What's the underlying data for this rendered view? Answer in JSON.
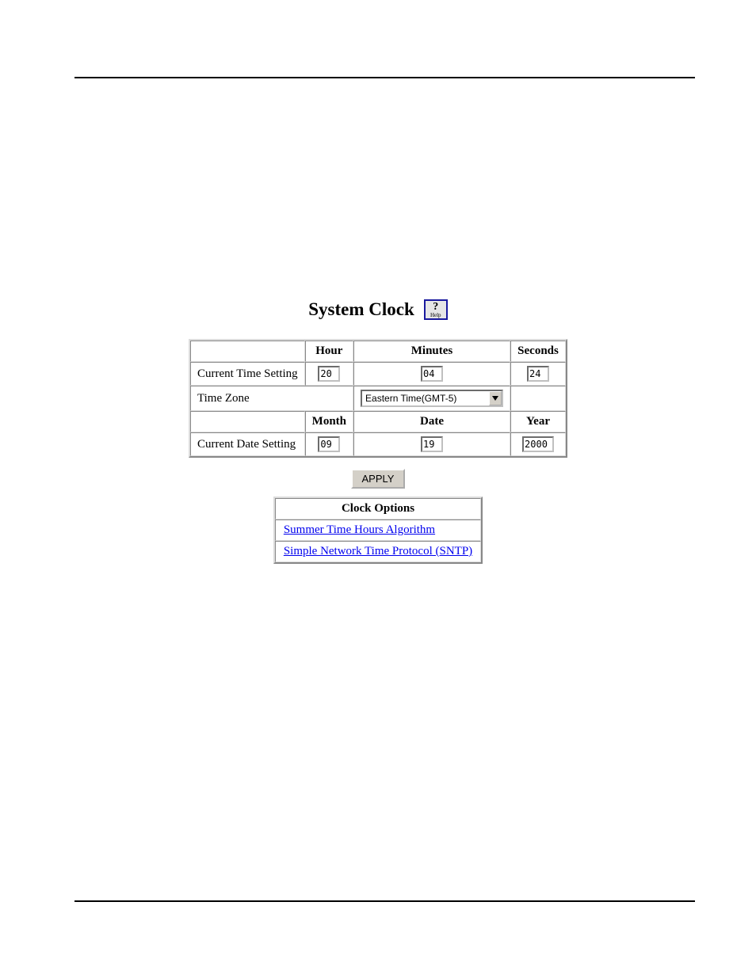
{
  "title": "System Clock",
  "help_label": "Help",
  "headers": {
    "hour": "Hour",
    "minutes": "Minutes",
    "seconds": "Seconds",
    "month": "Month",
    "date": "Date",
    "year": "Year"
  },
  "rows": {
    "current_time": "Current Time Setting",
    "time_zone": "Time Zone",
    "current_date": "Current Date Setting"
  },
  "time": {
    "hour": "20",
    "minutes": "04",
    "seconds": "24"
  },
  "timezone": "Eastern Time(GMT-5)",
  "date": {
    "month": "09",
    "day": "19",
    "year": "2000"
  },
  "apply_label": "APPLY",
  "options": {
    "header": "Clock Options",
    "links": [
      "Summer Time Hours Algorithm",
      "Simple Network Time Protocol (SNTP)"
    ]
  }
}
